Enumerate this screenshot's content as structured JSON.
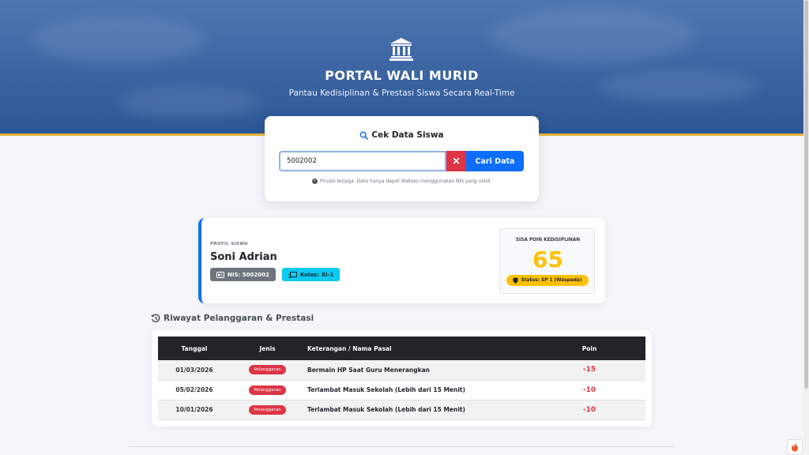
{
  "header": {
    "icon": "bank-icon",
    "title": "PORTAL WALI MURID",
    "subtitle": "Pantau Kedisiplinan & Prestasi Siswa Secara Real-Time"
  },
  "search": {
    "title": "Cek Data Siswa",
    "input_value": "5002002",
    "button_label": "Cari Data",
    "clear_label": "✕",
    "privacy_note": "Privasi terjaga. Data hanya dapat diakses menggunakan NIS yang valid."
  },
  "profile": {
    "label": "PROFIL SISWA",
    "name": "Soni Adrian",
    "nis": "NIS: 5002002",
    "kelas": "Kelas: XI-1",
    "points_label": "SISA POIN KEDISIPLINAN",
    "points_value": "65",
    "status": "Status: SP 1 (Waspada)",
    "status_color": "#ffc107"
  },
  "history": {
    "title": "Riwayat Pelanggaran & Prestasi",
    "columns": {
      "date": "Tanggal",
      "type": "Jenis",
      "desc": "Keterangan / Nama Pasal",
      "points": "Poin"
    },
    "rows": [
      {
        "date": "01/03/2026",
        "type": "Pelanggaran",
        "desc": "Bermain HP Saat Guru Menerangkan",
        "points": "-15"
      },
      {
        "date": "05/02/2026",
        "type": "Pelanggaran",
        "desc": "Terlambat Masuk Sekolah (Lebih dari 15 Menit)",
        "points": "-10"
      },
      {
        "date": "10/01/2026",
        "type": "Pelanggaran",
        "desc": "Terlambat Masuk Sekolah (Lebih dari 15 Menit)",
        "points": "-10"
      }
    ]
  },
  "colors": {
    "primary": "#0d6efd",
    "danger": "#dc3545",
    "warning": "#ffc107",
    "info": "#0dcaf0"
  }
}
